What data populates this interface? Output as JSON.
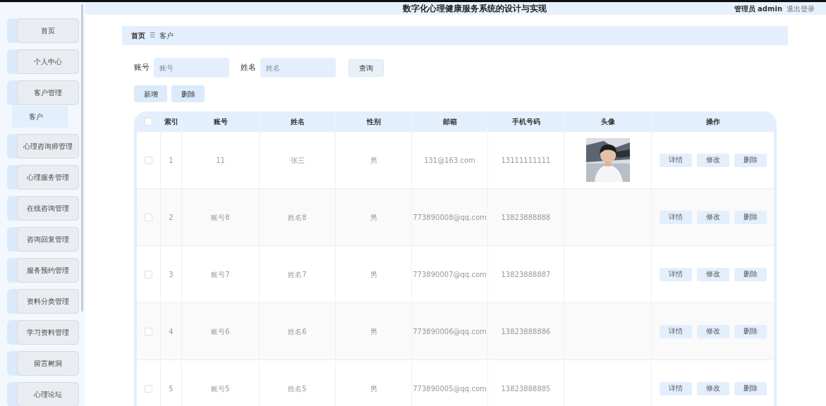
{
  "header": {
    "title": "数字化心理健康服务系统的设计与实现",
    "user": "管理员 admin",
    "logout": "退出登录"
  },
  "sidebar": {
    "items": [
      {
        "label": "首页"
      },
      {
        "label": "个人中心"
      },
      {
        "label": "客户管理",
        "children": [
          {
            "label": "客户",
            "selected": true
          }
        ]
      },
      {
        "label": "心理咨询师管理"
      },
      {
        "label": "心理服务管理"
      },
      {
        "label": "在线咨询管理"
      },
      {
        "label": "咨询回复管理"
      },
      {
        "label": "服务预约管理"
      },
      {
        "label": "资料分类管理"
      },
      {
        "label": "学习资料管理"
      },
      {
        "label": "留言树洞"
      },
      {
        "label": "心理论坛"
      }
    ]
  },
  "breadcrumb": {
    "items": [
      "首页",
      "客户"
    ],
    "separator": "☰"
  },
  "search": {
    "fields": [
      {
        "label": "账号",
        "placeholder": "账号"
      },
      {
        "label": "姓名",
        "placeholder": "姓名"
      }
    ],
    "button": "查询"
  },
  "actions": [
    "新增",
    "删除"
  ],
  "table": {
    "header_checkbox": {
      "checked": false
    },
    "columns": [
      "索引",
      "账号",
      "姓名",
      "性别",
      "邮箱",
      "手机号码",
      "头像",
      "操作"
    ],
    "rows": [
      {
        "checked": false,
        "cells": [
          "1",
          "11",
          "张三",
          "男",
          "131@163.com",
          "13111111111"
        ],
        "actions": [
          "详情",
          "修改",
          "删除"
        ]
      },
      {
        "checked": false,
        "cells": [
          "2",
          "账号8",
          "姓名8",
          "男",
          "773890008@qq.com",
          "13823888888"
        ],
        "actions": [
          "详情",
          "修改",
          "删除"
        ]
      },
      {
        "checked": false,
        "cells": [
          "3",
          "账号7",
          "姓名7",
          "男",
          "773890007@qq.com",
          "13823888887"
        ],
        "actions": [
          "详情",
          "修改",
          "删除"
        ]
      },
      {
        "checked": false,
        "cells": [
          "4",
          "账号6",
          "姓名6",
          "男",
          "773890006@qq.com",
          "13823888886"
        ],
        "actions": [
          "详情",
          "修改",
          "删除"
        ]
      },
      {
        "checked": false,
        "cells": [
          "5",
          "账号5",
          "姓名5",
          "男",
          "773890005@qq.com",
          "13823888885"
        ],
        "actions": [
          "详情",
          "修改",
          "删除"
        ]
      }
    ]
  }
}
